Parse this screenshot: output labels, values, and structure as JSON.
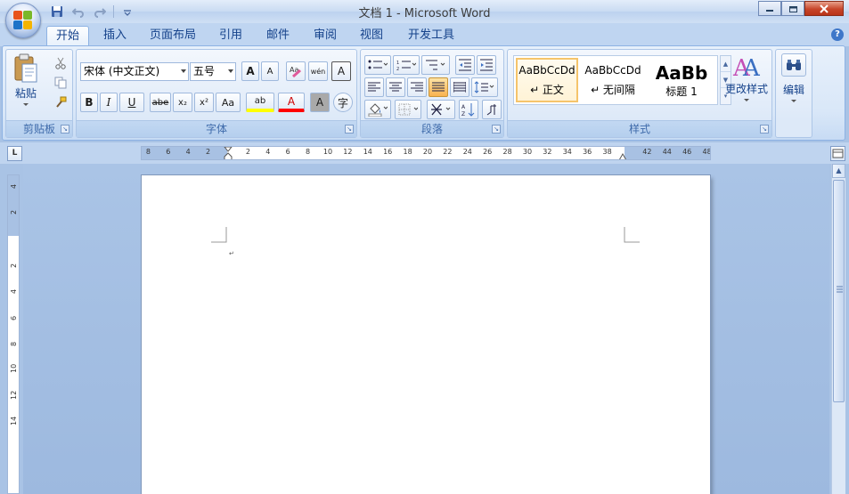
{
  "window": {
    "title": "文档 1 - Microsoft Word",
    "controls": [
      "minimize",
      "restore",
      "close"
    ]
  },
  "quick_access": [
    "save-icon",
    "undo-icon",
    "redo-icon",
    "customize-icon"
  ],
  "tabs": [
    {
      "label": "开始",
      "active": true
    },
    {
      "label": "插入",
      "active": false
    },
    {
      "label": "页面布局",
      "active": false
    },
    {
      "label": "引用",
      "active": false
    },
    {
      "label": "邮件",
      "active": false
    },
    {
      "label": "审阅",
      "active": false
    },
    {
      "label": "视图",
      "active": false
    },
    {
      "label": "开发工具",
      "active": false
    }
  ],
  "groups": {
    "clipboard": {
      "label": "剪贴板",
      "paste_label": "粘贴"
    },
    "font": {
      "label": "字体",
      "font_name": "宋体 (中文正文)",
      "font_size": "五号",
      "grow_font": "A",
      "shrink_font": "A",
      "phonetic": "wén",
      "char_border": "A",
      "bold": "B",
      "italic": "I",
      "underline": "U",
      "strikethrough": "abe",
      "subscript": "x₂",
      "superscript": "x²",
      "change_case": "Aa",
      "highlight": "ab",
      "font_color": "A",
      "char_shading": "A",
      "enclose_char": "字"
    },
    "paragraph": {
      "label": "段落"
    },
    "styles": {
      "label": "样式",
      "items": [
        {
          "preview": "AaBbCcDd",
          "name": "↵ 正文",
          "selected": true
        },
        {
          "preview": "AaBbCcDd",
          "name": "↵ 无间隔",
          "selected": false
        },
        {
          "preview": "AaBb",
          "name": "标题 1",
          "selected": false
        }
      ],
      "change_styles_label": "更改样式"
    },
    "editing": {
      "label": "编辑"
    }
  },
  "ruler": {
    "ticks": [
      "8",
      "6",
      "4",
      "2",
      "2",
      "4",
      "6",
      "8",
      "10",
      "12",
      "14",
      "16",
      "18",
      "20",
      "22",
      "24",
      "26",
      "28",
      "30",
      "32",
      "34",
      "36",
      "38",
      "42",
      "44",
      "46",
      "48"
    ],
    "vticks": [
      "4",
      "2",
      "2",
      "4",
      "6",
      "8",
      "10",
      "12",
      "14"
    ]
  },
  "document": {
    "paragraph_mark": "↵"
  },
  "colors": {
    "accent": "#15428b",
    "highlight": "#ffff00",
    "font_color": "#ff0000"
  }
}
